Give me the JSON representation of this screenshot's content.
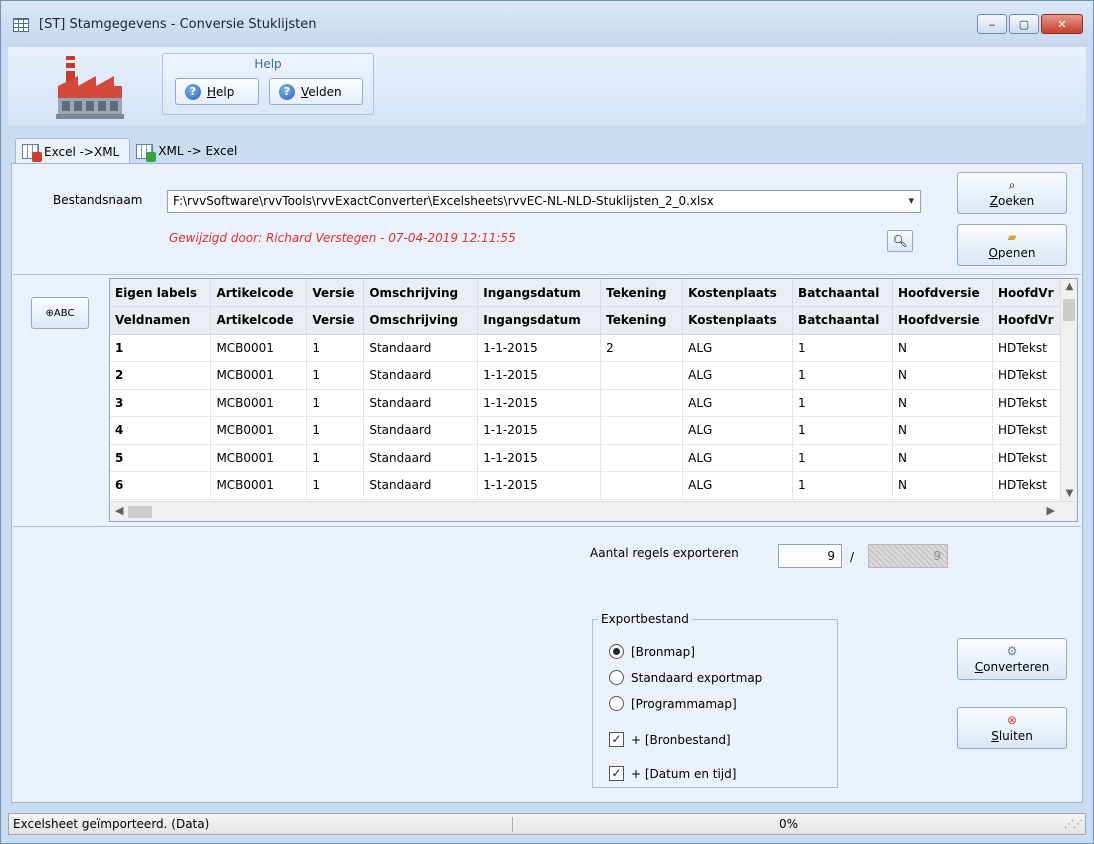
{
  "window": {
    "title": "[ST]  Stamgegevens - Conversie Stuklijsten",
    "controls": {
      "minimize": "‒",
      "maximize": "▢",
      "close": "✕"
    }
  },
  "ribbon": {
    "group_title": "Help",
    "buttons": [
      {
        "label": "Help",
        "icon": "help-icon"
      },
      {
        "label": "Velden",
        "icon": "help-icon"
      }
    ]
  },
  "tabs": [
    {
      "label": "Excel ->XML",
      "active": true,
      "icon": "excel-import-icon"
    },
    {
      "label": "XML -> Excel",
      "active": false,
      "icon": "excel-export-icon"
    }
  ],
  "file": {
    "label": "Bestandsnaam",
    "value": "F:\\rvvSoftware\\rvvTools\\rvvExactConverter\\Excelsheets\\rvvEC-NL-NLD-Stuklijsten_2_0.xlsx",
    "modified_by": "Gewijzigd door: Richard Verstegen   -   07-04-2019  12:11:55"
  },
  "buttons": {
    "zoeken": "Zoeken",
    "openen": "Openen",
    "converteren": "Converteren",
    "sluiten": "Sluiten"
  },
  "grid": {
    "columns": [
      {
        "label": "Eigen labels",
        "field": "Veldnamen"
      },
      {
        "label": "Artikelcode",
        "field": "Artikelcode"
      },
      {
        "label": "Versie",
        "field": "Versie"
      },
      {
        "label": "Omschrijving",
        "field": "Omschrijving"
      },
      {
        "label": "Ingangsdatum",
        "field": "Ingangsdatum"
      },
      {
        "label": "Tekening",
        "field": "Tekening"
      },
      {
        "label": "Kostenplaats",
        "field": "Kostenplaats"
      },
      {
        "label": "Batchaantal",
        "field": "Batchaantal"
      },
      {
        "label": "Hoofdversie",
        "field": "Hoofdversie"
      },
      {
        "label": "HoofdVr",
        "field": "HoofdVr"
      }
    ],
    "rows": [
      [
        "1",
        "MCB0001",
        "1",
        "Standaard",
        "1-1-2015",
        "2",
        "ALG",
        "1",
        "N",
        "HDTekst"
      ],
      [
        "2",
        "MCB0001",
        "1",
        "Standaard",
        "1-1-2015",
        "",
        "ALG",
        "1",
        "N",
        "HDTekst"
      ],
      [
        "3",
        "MCB0001",
        "1",
        "Standaard",
        "1-1-2015",
        "",
        "ALG",
        "1",
        "N",
        "HDTekst"
      ],
      [
        "4",
        "MCB0001",
        "1",
        "Standaard",
        "1-1-2015",
        "",
        "ALG",
        "1",
        "N",
        "HDTekst"
      ],
      [
        "5",
        "MCB0001",
        "1",
        "Standaard",
        "1-1-2015",
        "",
        "ALG",
        "1",
        "N",
        "HDTekst"
      ],
      [
        "6",
        "MCB0001",
        "1",
        "Standaard",
        "1-1-2015",
        "",
        "ALG",
        "1",
        "N",
        "HDTekst"
      ]
    ]
  },
  "export": {
    "count_label": "Aantal regels exporteren",
    "count_value": "9",
    "separator": "/",
    "total_value": "9",
    "group_title": "Exportbestand",
    "options": [
      {
        "label": "[Bronmap]",
        "selected": true
      },
      {
        "label": "Standaard exportmap",
        "selected": false
      },
      {
        "label": "[Programmamap]",
        "selected": false
      }
    ],
    "checks": [
      {
        "label": "+ [Bronbestand]",
        "checked": true
      },
      {
        "label": "+ [Datum en tijd]",
        "checked": true
      }
    ]
  },
  "status": {
    "message": "Excelsheet geïmporteerd. (Data)",
    "progress": "0%"
  }
}
